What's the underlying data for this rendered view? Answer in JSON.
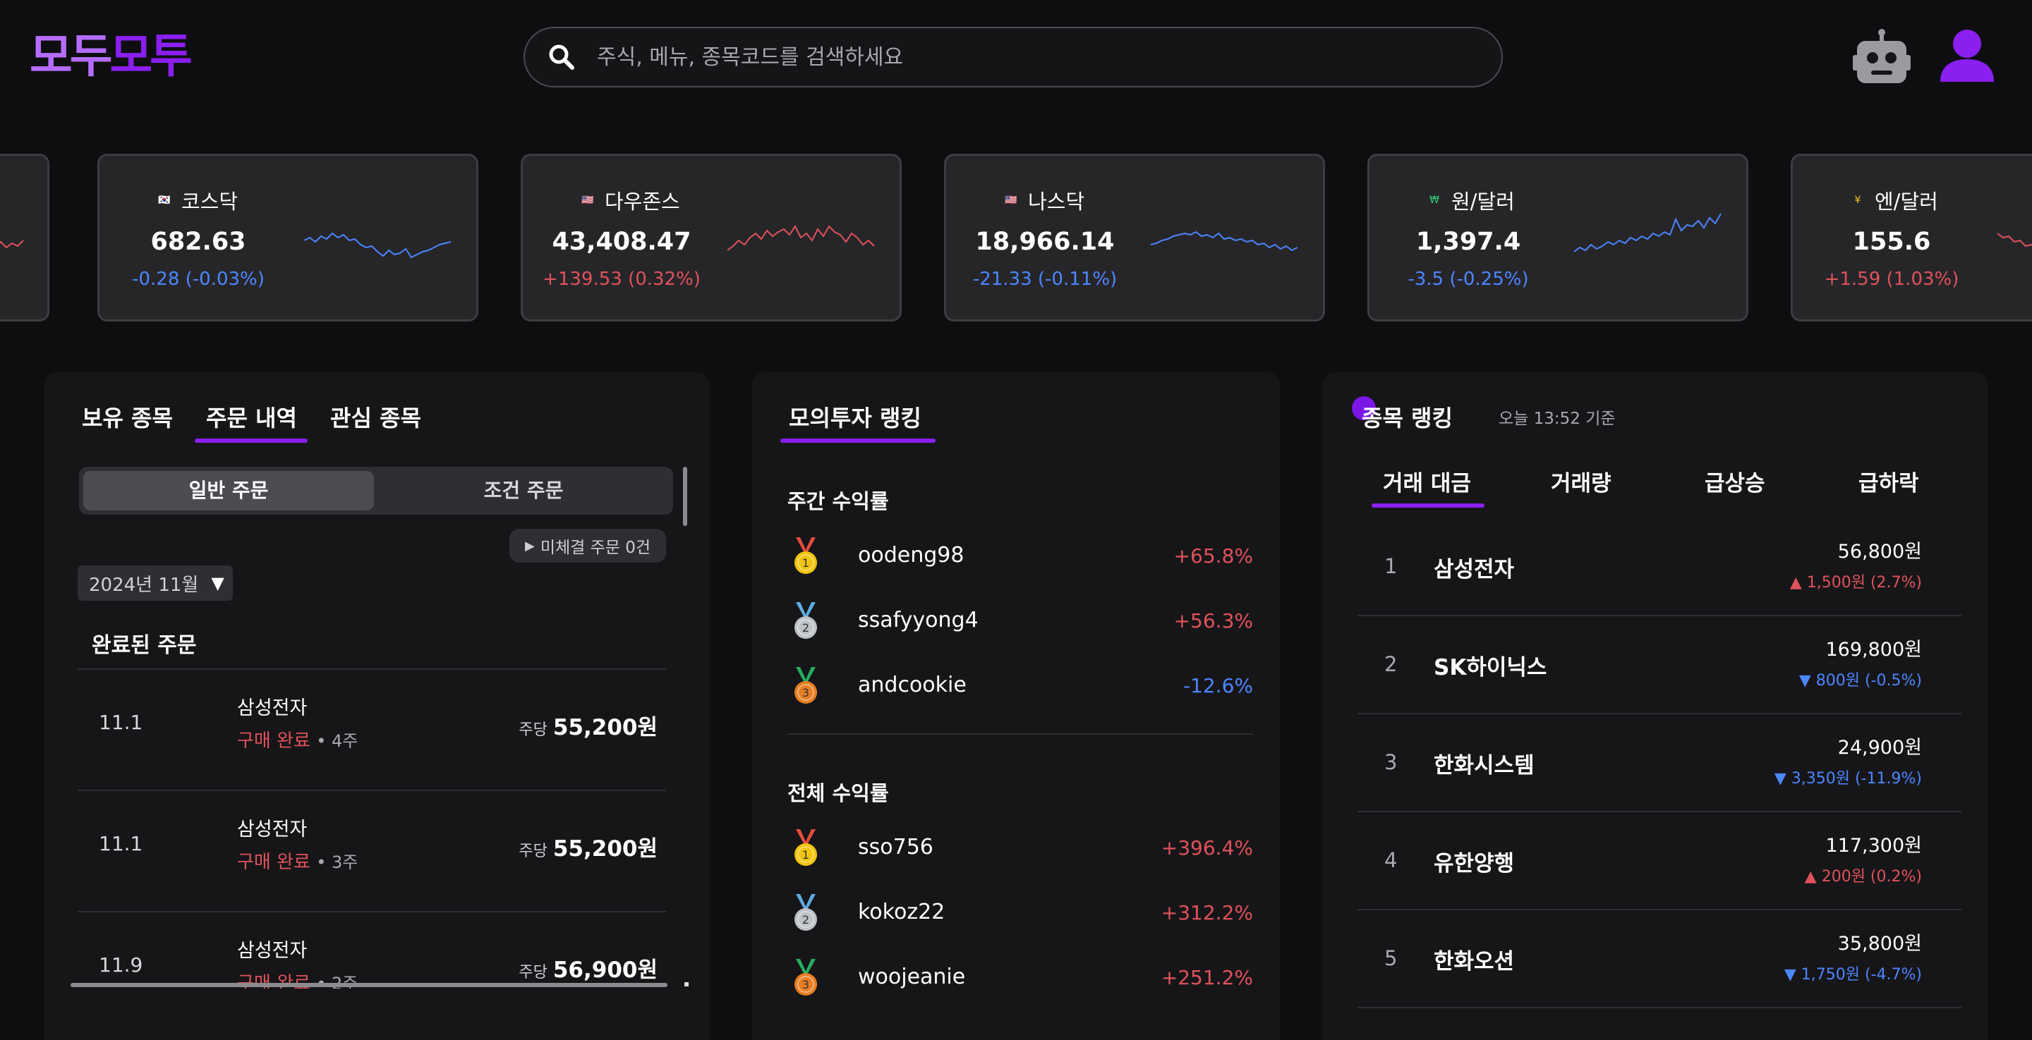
{
  "header": {
    "logo_part1": "모두",
    "logo_part2": "모투",
    "search_placeholder": "주식, 메뉴, 종목코드를 검색하세요",
    "search_icon": "search-icon",
    "bot_icon": "robot-icon",
    "user_icon": "user-icon"
  },
  "tickers": [
    {
      "flag": "🇰🇷",
      "name": "코스닥",
      "value": "682.63",
      "change": "-0.28 (-0.03%)",
      "direction": "down",
      "spark": [
        50,
        46,
        52,
        44,
        48,
        40,
        46,
        42,
        50,
        48,
        56,
        60,
        58,
        66,
        72,
        64,
        70,
        68,
        62,
        74,
        70,
        66,
        64,
        60,
        56,
        54,
        52
      ]
    },
    {
      "flag": "🇺🇸",
      "name": "다우존스",
      "value": "43,408.47",
      "change": "+139.53 (0.32%)",
      "direction": "up",
      "spark": [
        64,
        58,
        50,
        56,
        46,
        40,
        48,
        36,
        44,
        38,
        34,
        42,
        30,
        46,
        40,
        50,
        34,
        44,
        30,
        38,
        42,
        52,
        40,
        46,
        56,
        50,
        58
      ]
    },
    {
      "flag": "🇺🇸",
      "name": "나스닥",
      "value": "18,966.14",
      "change": "-21.33 (-0.11%)",
      "direction": "down",
      "spark": [
        56,
        54,
        50,
        48,
        44,
        42,
        40,
        42,
        38,
        44,
        42,
        46,
        40,
        48,
        46,
        50,
        48,
        52,
        50,
        56,
        54,
        60,
        56,
        62,
        58,
        64,
        60
      ]
    },
    {
      "flag": "₩",
      "name": "원/달러",
      "value": "1,397.4",
      "change": "-3.5 (-0.25%)",
      "direction": "down",
      "spark": [
        66,
        60,
        64,
        56,
        62,
        58,
        52,
        56,
        50,
        54,
        46,
        50,
        44,
        48,
        40,
        44,
        38,
        42,
        20,
        36,
        28,
        30,
        22,
        32,
        18,
        26,
        12
      ]
    },
    {
      "flag": "¥",
      "name": "엔/달러",
      "value": "155.6",
      "change": "+1.59 (1.03%)",
      "direction": "up",
      "spark": [
        40,
        46,
        44,
        52,
        50,
        58,
        56,
        62,
        60,
        66,
        64,
        70,
        68,
        72,
        70,
        74,
        72,
        76,
        74,
        78,
        76,
        80,
        78,
        82,
        80,
        84,
        82
      ]
    }
  ],
  "holdings": {
    "tabs": [
      "보유 종목",
      "주문 내역",
      "관심 종목"
    ],
    "segments": [
      "일반 주문",
      "조건 주문"
    ],
    "pending": "미체결 주문 0건",
    "month": "2024년 11월",
    "section": "완료된 주문",
    "price_prefix": "주당",
    "orders": [
      {
        "date": "11.1",
        "name": "삼성전자",
        "status": "구매 완료",
        "qty": "• 4주",
        "price": "55,200원"
      },
      {
        "date": "11.1",
        "name": "삼성전자",
        "status": "구매 완료",
        "qty": "• 3주",
        "price": "55,200원"
      },
      {
        "date": "11.9",
        "name": "삼성전자",
        "status": "구매 완료",
        "qty": "• 2주",
        "price": "56,900원"
      }
    ]
  },
  "ranking": {
    "title": "모의투자 랭킹",
    "weekly_title": "주간 수익률",
    "weekly": [
      {
        "user": "oodeng98",
        "rate": "+65.8%",
        "medal": "gold"
      },
      {
        "user": "ssafyyong4",
        "rate": "+56.3%",
        "medal": "silver"
      },
      {
        "user": "andcookie",
        "rate": "-12.6%",
        "medal": "bronze"
      }
    ],
    "total_title": "전체 수익률",
    "total": [
      {
        "user": "sso756",
        "rate": "+396.4%",
        "medal": "gold"
      },
      {
        "user": "kokoz22",
        "rate": "+312.2%",
        "medal": "silver"
      },
      {
        "user": "woojeanie",
        "rate": "+251.2%",
        "medal": "bronze"
      }
    ]
  },
  "stock_ranking": {
    "title": "종목 랭킹",
    "time": "오늘 13:52 기준",
    "tabs": [
      "거래 대금",
      "거래량",
      "급상승",
      "급하락"
    ],
    "rows": [
      {
        "rank": "1",
        "name": "삼성전자",
        "price": "56,800원",
        "change": "▲ 1,500원 (2.7%)",
        "direction": "up"
      },
      {
        "rank": "2",
        "name": "SK하이닉스",
        "price": "169,800원",
        "change": "▼ 800원 (-0.5%)",
        "direction": "down"
      },
      {
        "rank": "3",
        "name": "한화시스템",
        "price": "24,900원",
        "change": "▼ 3,350원 (-11.9%)",
        "direction": "down"
      },
      {
        "rank": "4",
        "name": "유한양행",
        "price": "117,300원",
        "change": "▲ 200원 (0.2%)",
        "direction": "up"
      },
      {
        "rank": "5",
        "name": "한화오션",
        "price": "35,800원",
        "change": "▼ 1,750원 (-4.7%)",
        "direction": "down"
      }
    ]
  },
  "colors": {
    "accent": "#8a1ff0",
    "up": "#e0525a",
    "down": "#4c86ff"
  }
}
